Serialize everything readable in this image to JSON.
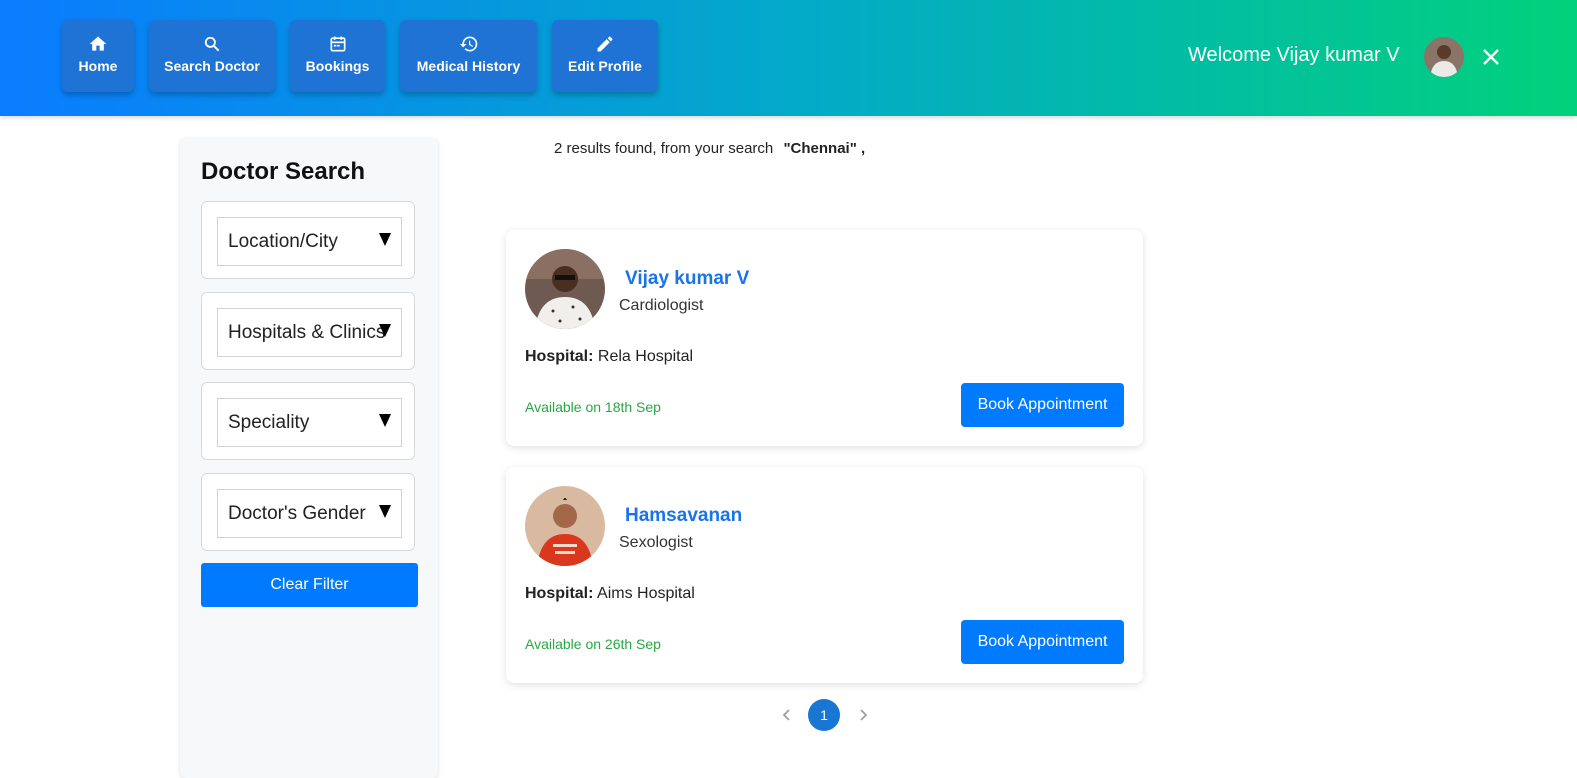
{
  "nav": {
    "items": [
      {
        "label": "Home",
        "icon": "home-icon"
      },
      {
        "label": "Search Doctor",
        "icon": "search-icon"
      },
      {
        "label": "Bookings",
        "icon": "calendar-icon"
      },
      {
        "label": "Medical History",
        "icon": "history-icon"
      },
      {
        "label": "Edit Profile",
        "icon": "pencil-icon"
      }
    ],
    "welcome": "Welcome Vijay kumar V"
  },
  "sidebar": {
    "title": "Doctor Search",
    "filters": [
      "Location/City",
      "Hospitals & Clinics",
      "Speciality",
      "Doctor's Gender"
    ],
    "clear_label": "Clear Filter"
  },
  "results": {
    "summary": "2 results found, from your search",
    "query": "\"Chennai\" ,"
  },
  "doctors": [
    {
      "name": "Vijay kumar V",
      "speciality": "Cardiologist",
      "hospital_label": "Hospital:",
      "hospital": "Rela Hospital",
      "availability": "Available on 18th Sep",
      "book_label": "Book Appointment"
    },
    {
      "name": "Hamsavanan",
      "speciality": "Sexologist",
      "hospital_label": "Hospital:",
      "hospital": "Aims Hospital",
      "availability": "Available on 26th Sep",
      "book_label": "Book Appointment"
    }
  ],
  "pagination": {
    "current": "1"
  },
  "colors": {
    "primary": "#007bff",
    "doctor_name": "#1a73e8",
    "available": "#28a745"
  }
}
